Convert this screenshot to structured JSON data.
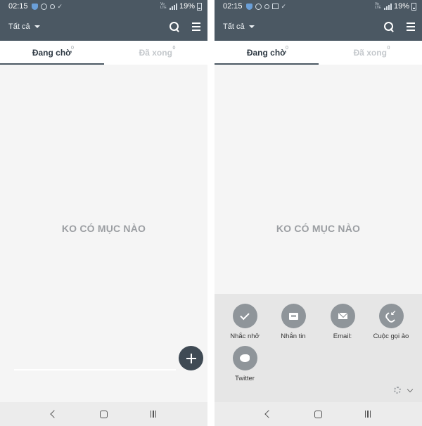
{
  "left": {
    "status": {
      "time": "02:15",
      "battery": "19%"
    },
    "appbar": {
      "filter_label": "Tất cả"
    },
    "tabs": {
      "pending_label": "Đang chờ",
      "pending_count": "0",
      "done_label": "Đã xong",
      "done_count": "0"
    },
    "empty_message": "KO CÓ MỤC NÀO"
  },
  "right": {
    "status": {
      "time": "02:15",
      "battery": "19%"
    },
    "appbar": {
      "filter_label": "Tất cả"
    },
    "tabs": {
      "pending_label": "Đang chờ",
      "pending_count": "0",
      "done_label": "Đã xong",
      "done_count": "0"
    },
    "empty_message": "KO CÓ MỤC NÀO",
    "quick_actions": [
      {
        "label": "Nhắc nhở",
        "icon": "check-icon"
      },
      {
        "label": "Nhắn tin",
        "icon": "message-icon"
      },
      {
        "label": "Email:",
        "icon": "email-icon"
      },
      {
        "label": "Cuộc gọi ảo",
        "icon": "missed-call-icon"
      },
      {
        "label": "Twitter",
        "icon": "twitter-icon"
      }
    ]
  },
  "colors": {
    "appbar": "#4b5863",
    "fab": "#3f4a54",
    "action_circle": "#8f959a",
    "panel": "#e6e6e6"
  }
}
